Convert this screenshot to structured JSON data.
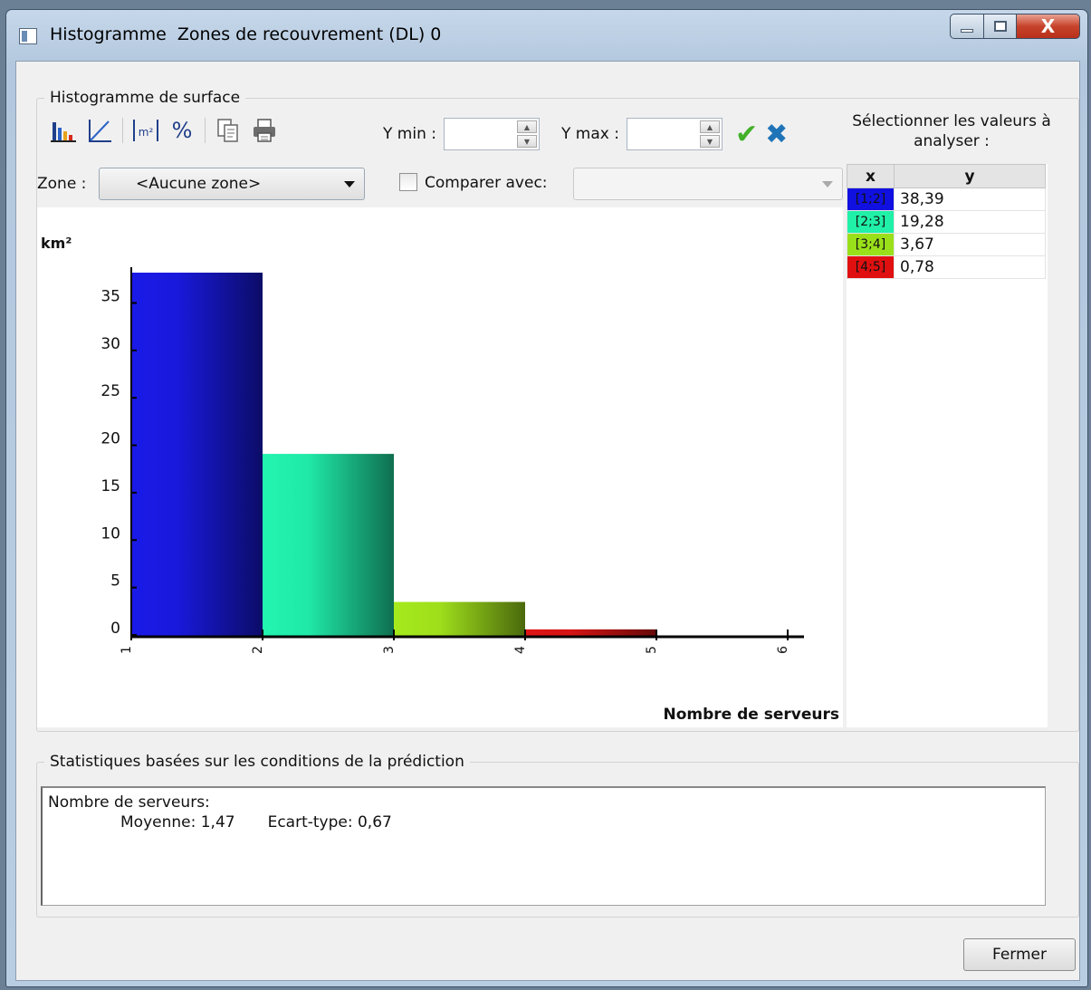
{
  "window": {
    "title": "Histogramme  Zones de recouvrement (DL) 0",
    "close_glyph": "X"
  },
  "histogram_group": {
    "title": "Histogramme de surface",
    "toolbar": {
      "percent_label": "%",
      "area_label": "m²"
    },
    "ymin_label": "Y min :",
    "ymin_value": "",
    "ymax_label": "Y max :",
    "ymax_value": "",
    "zone_label": "Zone :",
    "zone_value": "<Aucune zone>",
    "compare_label": "Comparer avec:",
    "compare_value": "",
    "select_values_title": "Sélectionner les valeurs à analyser :",
    "table": {
      "headers": [
        "x",
        "y"
      ],
      "rows": [
        {
          "x": "[1;2]",
          "y": "38,39",
          "color": "#1010e0"
        },
        {
          "x": "[2;3]",
          "y": "19,28",
          "color": "#20f0a8"
        },
        {
          "x": "[3;4]",
          "y": "3,67",
          "color": "#9ae01a"
        },
        {
          "x": "[4;5]",
          "y": "0,78",
          "color": "#e01010"
        }
      ]
    }
  },
  "chart_data": {
    "type": "bar",
    "categories": [
      "[1;2]",
      "[2;3]",
      "[3;4]",
      "[4;5]"
    ],
    "x_edges": [
      1,
      2,
      3,
      4,
      5
    ],
    "values": [
      38.39,
      19.28,
      3.67,
      0.78
    ],
    "colors": [
      "#1a1ae8",
      "#22f5b0",
      "#a6ea1c",
      "#e01515"
    ],
    "ylabel": "km²",
    "xlabel": "Nombre de serveurs",
    "xlim": [
      1,
      6
    ],
    "ylim": [
      0,
      38.39
    ],
    "xticks": [
      1,
      2,
      3,
      4,
      5,
      6
    ],
    "yticks": [
      0,
      5,
      10,
      15,
      20,
      25,
      30,
      35
    ],
    "grid": false,
    "legend": "none"
  },
  "stats_group": {
    "title": "Statistiques basées sur les conditions de la prédiction",
    "line1": "Nombre de serveurs:",
    "mean": "Moyenne: 1,47",
    "stddev": "Ecart-type: 0,67"
  },
  "close_button": "Fermer"
}
